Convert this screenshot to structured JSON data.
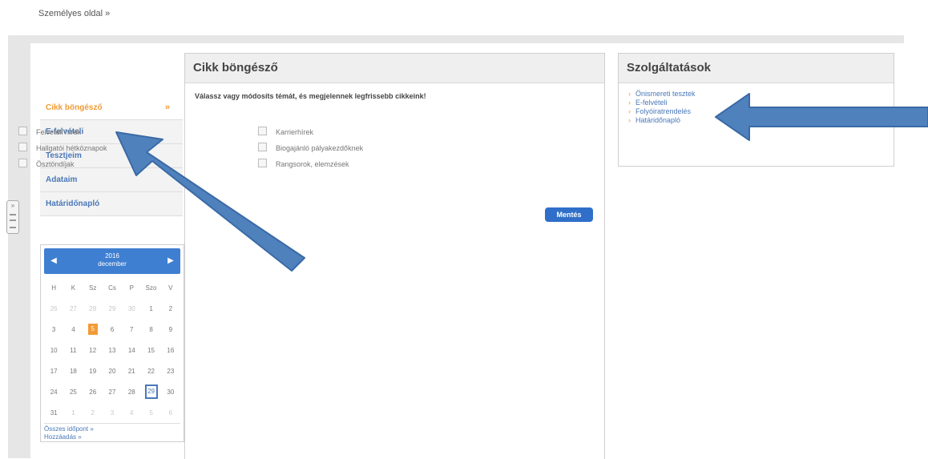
{
  "header": {
    "personal_page_link": "Személyes oldal »"
  },
  "sidebar": {
    "items": [
      {
        "label": "Cikk böngésző",
        "active": true
      },
      {
        "label": "E-felvételi"
      },
      {
        "label": "Tesztjeim"
      },
      {
        "label": "Adataim"
      },
      {
        "label": "Határidőnapló"
      }
    ],
    "active_chevron": "»"
  },
  "calendar": {
    "year": "2016",
    "month": "december",
    "weekdays": [
      "H",
      "K",
      "Sz",
      "Cs",
      "P",
      "Szo",
      "V"
    ],
    "weeks": [
      [
        "26",
        "27",
        "28",
        "29",
        "30",
        "1",
        "2"
      ],
      [
        "3",
        "4",
        "5",
        "6",
        "7",
        "8",
        "9"
      ],
      [
        "10",
        "11",
        "12",
        "13",
        "14",
        "15",
        "16"
      ],
      [
        "17",
        "18",
        "19",
        "20",
        "21",
        "22",
        "23"
      ],
      [
        "24",
        "25",
        "26",
        "27",
        "28",
        "29",
        "30"
      ],
      [
        "31",
        "1",
        "2",
        "3",
        "4",
        "5",
        "6"
      ]
    ],
    "footer_links": [
      "Összes időpont »",
      "Hozzáadás »"
    ]
  },
  "article_browser": {
    "title": "Cikk böngésző",
    "intro": "Válassz vagy módosíts témát, és megjelennek legfrissebb cikkeink!",
    "topics_left": [
      "Felvételi hírek",
      "Hallgatói hétköznapok",
      "Ösztöndíjak"
    ],
    "topics_right": [
      "Karrierhírek",
      "Biogajánló pályakezdőknek",
      "Rangsorok, elemzések"
    ],
    "save_label": "Mentés"
  },
  "services": {
    "title": "Szolgáltatások",
    "items": [
      "Önismereti tesztek",
      "E-felvételi",
      "Folyóiratrendelés",
      "Határidőnapló"
    ]
  },
  "colors": {
    "accent_orange": "#f29b36",
    "link_blue": "#4a78b8",
    "button_blue": "#2f6fc9",
    "annotation_arrow": "#4f81bd"
  }
}
